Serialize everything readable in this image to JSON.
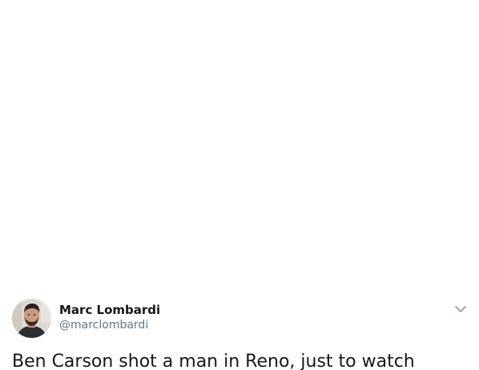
{
  "tweet": {
    "author_name": "Marc Lombardi",
    "author_handle": "@marclombardi",
    "text": "Ben Carson shot a man in Reno, just to watch",
    "avatar_icon": "profile-photo",
    "menu_icon": "chevron-down-icon"
  }
}
